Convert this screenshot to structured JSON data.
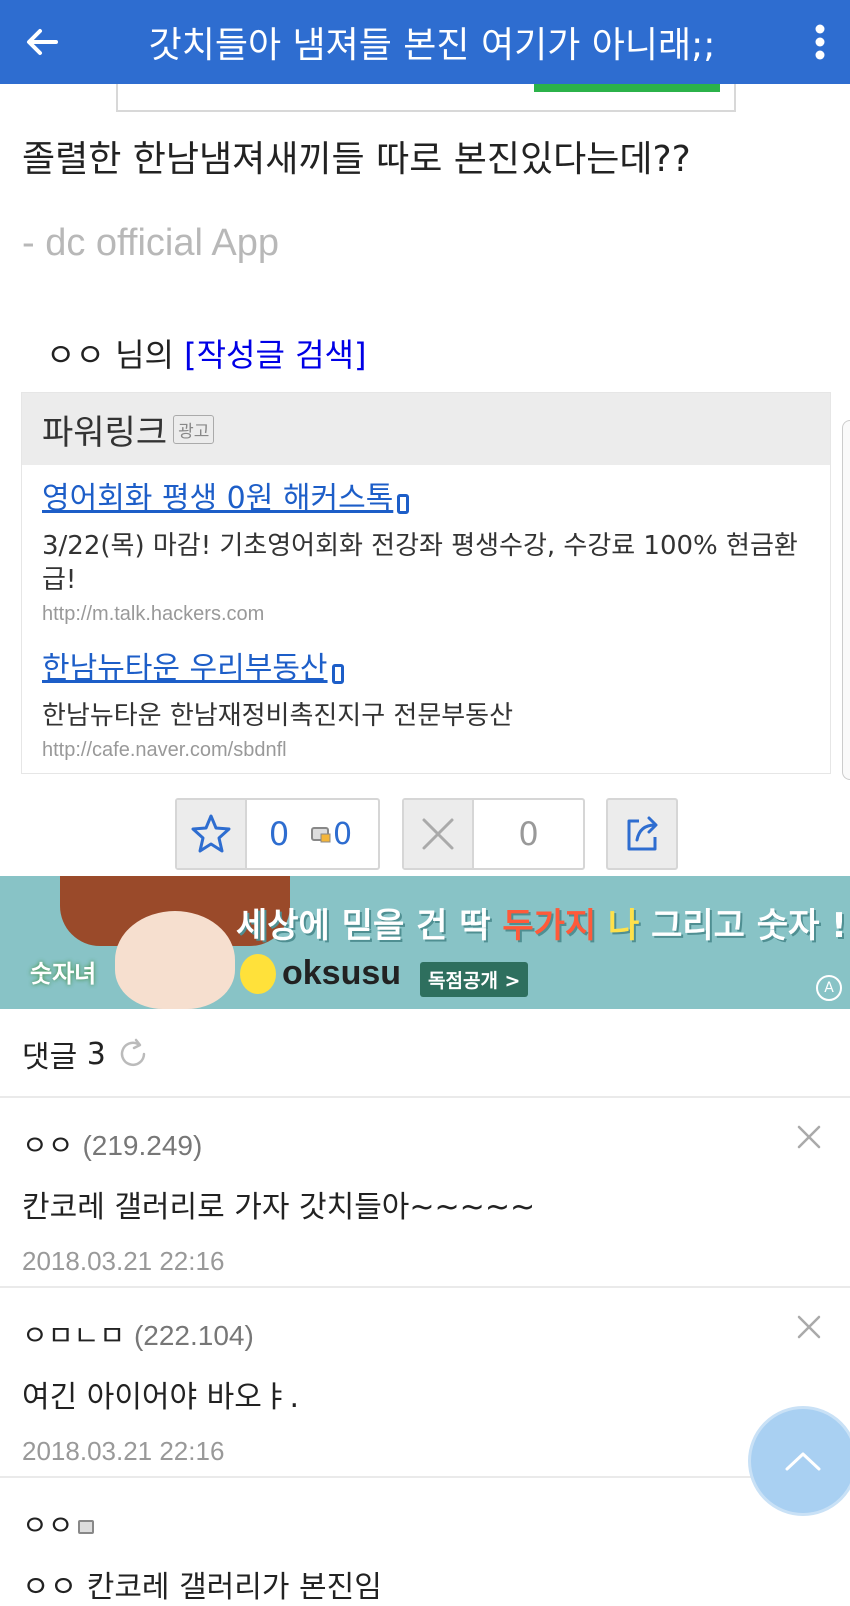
{
  "appbar": {
    "title": "갓치들아 냄져들 본진 여기가 아니래;;",
    "back_icon": "arrow-left-icon",
    "more_icon": "more-vertical-icon"
  },
  "post": {
    "body": "졸렬한 한남냄져새끼들 따로 본진있다는데??",
    "signature": "- dc official App",
    "author": "ㅇㅇ",
    "author_suffix": " 님의 ",
    "search_link": "[작성글 검색]"
  },
  "powerlink": {
    "title": "파워링크",
    "badge": "광고",
    "ads": [
      {
        "title": "영어회화 평생 0원 해커스톡",
        "description": "3/22(목) 마감! 기초영어회화 전강좌 평생수강, 수강료 100% 현금환급!",
        "url": "http://m.talk.hackers.com"
      },
      {
        "title": "한남뉴타운 우리부동산",
        "description": "한남뉴타운 한남재정비촉진지구 전문부동산",
        "url": "http://cafe.naver.com/sbdnfl"
      }
    ]
  },
  "votes": {
    "recommend_count": "0",
    "mobile_recommend_count": "0",
    "not_recommend_count": "0"
  },
  "banner": {
    "show_name": "숫자녀",
    "tagline_pre": "세상에 믿을 건 딱 ",
    "tagline_hl": "두가지",
    "tagline_mid": " 나",
    "tagline_post": " 그리고 숫자 !",
    "brand": "oksusu",
    "cta": "독점공개 >"
  },
  "comments": {
    "label": "댓글",
    "count": "3",
    "items": [
      {
        "nick": "ㅇㅇ",
        "ip": "(219.249)",
        "text": "칸코레 갤러리로 가자 갓치들아~~~~~",
        "date": "2018.03.21 22:16"
      },
      {
        "nick": "ㅇㅁㄴㅁ",
        "ip": "(222.104)",
        "text": "여긴 아이어야 바오ㅑ.",
        "date": "2018.03.21 22:16"
      },
      {
        "nick": "ㅇㅇ",
        "ip": "",
        "text": "ㅇㅇ 칸코레 갤러리가 본진임",
        "date": ""
      }
    ]
  },
  "colors": {
    "appbar": "#2e6dd0",
    "link": "#1d5ec8",
    "search_link": "#0000e6"
  }
}
